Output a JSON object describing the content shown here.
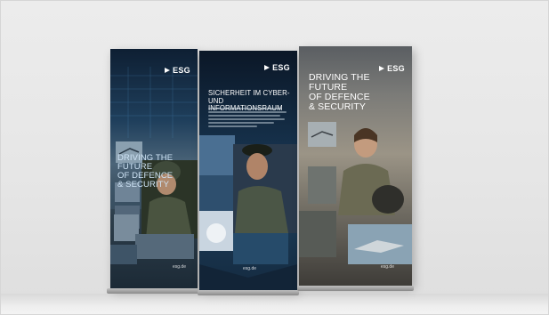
{
  "banners": [
    {
      "logo": "ESG",
      "headline_lines": [
        "DRIVING THE FUTURE",
        "OF DEFENCE",
        "& SECURITY"
      ],
      "url": "esg.de"
    },
    {
      "logo": "ESG",
      "headline_lines": [
        "SICHERHEIT IM CYBER-",
        "UND INFORMATIONSRAUM"
      ],
      "url": "esg.de"
    },
    {
      "logo": "ESG",
      "headline_lines": [
        "DRIVING THE FUTURE",
        "OF DEFENCE",
        "& SECURITY"
      ],
      "url": "esg.de"
    }
  ],
  "colors": {
    "background": "#e8e8e8",
    "banner_navy": "#16314b",
    "banner_sky": "#8a8679",
    "text_light": "#ffffff",
    "headline_blue": "#cfe4f6",
    "stand_metal": "#9a9a9a"
  },
  "icons": {
    "logo_mark": "esg-logo-mark-icon"
  }
}
